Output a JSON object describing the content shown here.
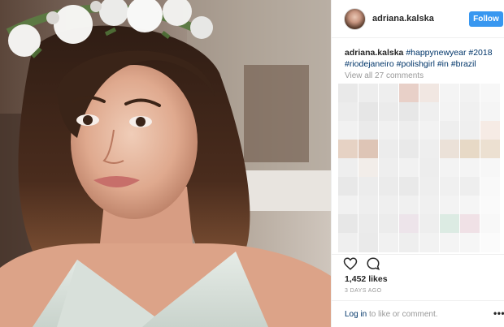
{
  "post": {
    "username": "adriana.kalska",
    "follow_label": "Follow",
    "caption": {
      "user": "adriana.kalska",
      "hashtags": [
        "#happynewyear",
        "#2018",
        "#riodejaneiro",
        "#polishgirl",
        "#in",
        "#brazil"
      ]
    },
    "view_all_comments": "View all 27 comments",
    "likes": "1,452 likes",
    "time_ago": "3 DAYS AGO",
    "login_link": "Log in",
    "login_text": " to like or comment.",
    "more_options": "•••"
  },
  "colors": {
    "follow_button": "#3897f0",
    "hashtag_link": "#003569",
    "muted_text": "#999999",
    "divider": "#efefef"
  },
  "icons": {
    "like": "heart-icon",
    "comment": "speech-bubble-icon",
    "more": "more-options-icon"
  },
  "blurred_comments": {
    "palette": [
      [
        "#e9e9e9",
        "#ededed",
        "#eeeeee",
        "#e8d0c8",
        "#f1e7e2",
        "#f4f4f4",
        "#f2f2f2",
        "#f7f7f7"
      ],
      [
        "#ececec",
        "#e6e6e6",
        "#ebebeb",
        "#e7e7e7",
        "#efefef",
        "#f3f3f3",
        "#f0f0f0",
        "#f5f5f5"
      ],
      [
        "#f1f1f1",
        "#eaeaea",
        "#f0f0f0",
        "#ededed",
        "#f2f2f2",
        "#eeeeee",
        "#efefef",
        "#f6ebe5"
      ],
      [
        "#e6d2c4",
        "#dec5b6",
        "#ececec",
        "#e9e9e9",
        "#eeeeee",
        "#ebe1d8",
        "#e7d9c6",
        "#ece0d1"
      ],
      [
        "#eeeeee",
        "#f2ede9",
        "#eeeeee",
        "#f1f1f1",
        "#ededed",
        "#f3f3f3",
        "#f4f4f4",
        "#f7f7f7"
      ],
      [
        "#e8e8e8",
        "#ececec",
        "#ebebeb",
        "#e9e9e9",
        "#eeeeee",
        "#f0f0f0",
        "#eeeeee",
        "#f9f9f9"
      ],
      [
        "#f1f1f1",
        "#eeeeee",
        "#efefef",
        "#f0f0f0",
        "#f0f0f0",
        "#f3f3f3",
        "#f5f5f5",
        "#fafafa"
      ],
      [
        "#e7e7e7",
        "#ebebeb",
        "#ececec",
        "#ede4ea",
        "#eeeeee",
        "#dcebe3",
        "#f0e1e6",
        "#f8f8f8"
      ],
      [
        "#efefef",
        "#eaeaea",
        "#f1f1f1",
        "#eeeeee",
        "#f2f2f2",
        "#f4f4f4",
        "#f6f6f6",
        "#fbfbfb"
      ]
    ]
  }
}
